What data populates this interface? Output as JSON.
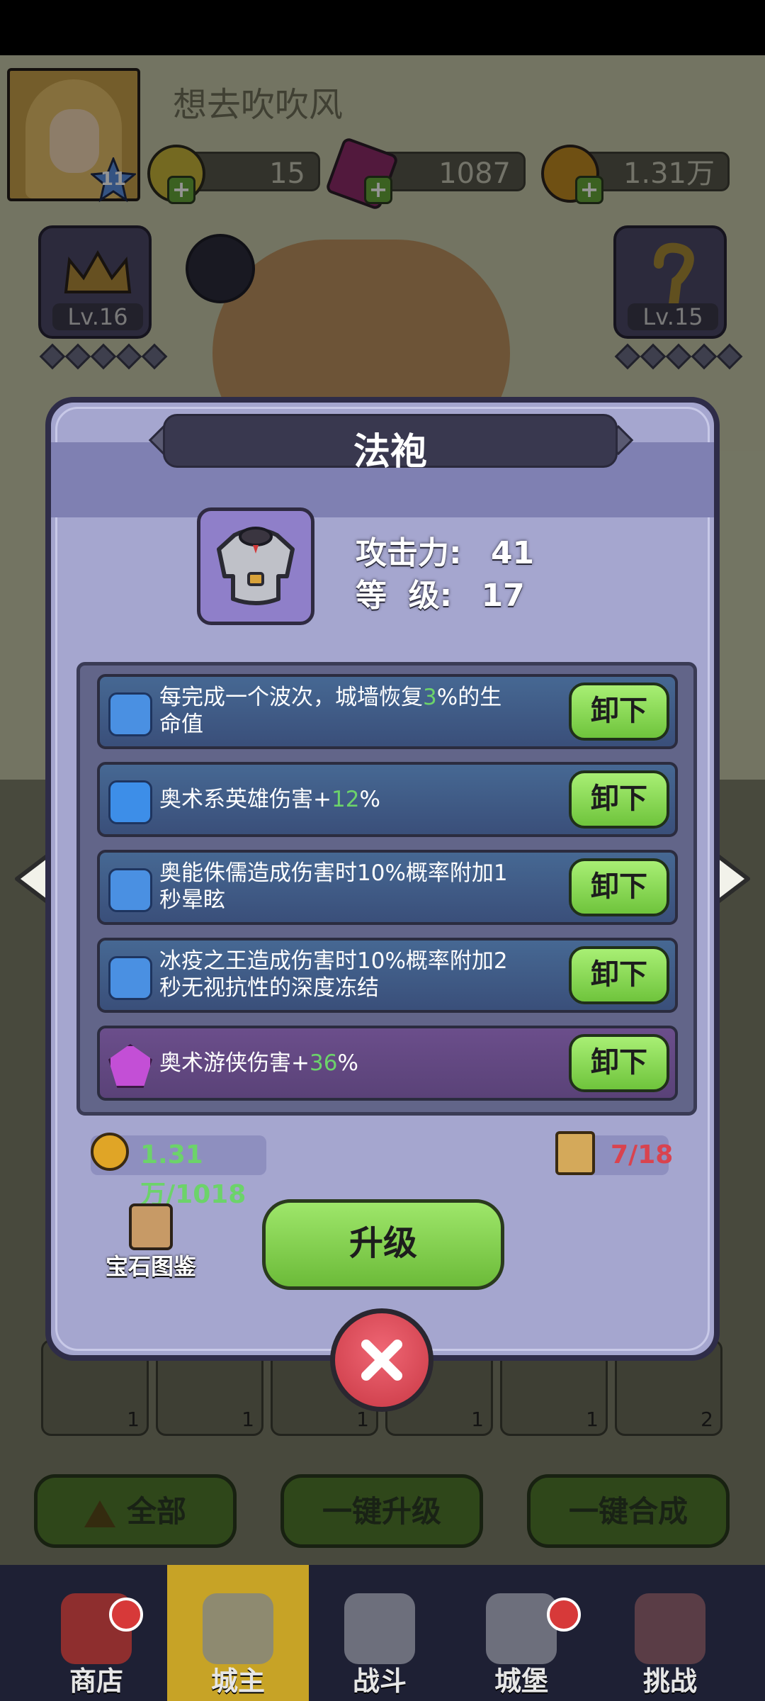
{
  "player": {
    "name": "想去吹吹风",
    "level": "11"
  },
  "resources": [
    {
      "icon": "hex-gem-icon",
      "value": "15"
    },
    {
      "icon": "crystal-icon",
      "value": "1087"
    },
    {
      "icon": "gold-coin-icon",
      "value": "1.31万"
    }
  ],
  "equip_slots": {
    "left_level": "Lv.16",
    "right_level": "Lv.15"
  },
  "bottom_buttons": {
    "all": "全部",
    "upgrade_all": "一键升级",
    "merge_all": "一键合成"
  },
  "nav": [
    {
      "label": "商店",
      "icon": "shop-icon"
    },
    {
      "label": "城主",
      "icon": "crown-icon"
    },
    {
      "label": "战斗",
      "icon": "swords-icon"
    },
    {
      "label": "城堡",
      "icon": "castle-icon"
    },
    {
      "label": "挑战",
      "icon": "demon-icon"
    }
  ],
  "inventory_counts": [
    "1",
    "1",
    "1",
    "1",
    "1",
    "2"
  ],
  "dialog": {
    "title": "法袍",
    "stats": {
      "attack_label": "攻击力:",
      "attack_value": "41",
      "level_label": "等  级:",
      "level_value": "17"
    },
    "gems": [
      {
        "icon": "blue-swirl-gem-icon",
        "pre": "每完成一个波次，城墙恢复",
        "hl": "3",
        "post": "%的生命值",
        "button": "卸下"
      },
      {
        "icon": "blue-hex-gem-icon",
        "pre": "奥术系英雄伤害+",
        "hl": "12",
        "post": "%",
        "button": "卸下"
      },
      {
        "icon": "blue-swirl-gem-icon",
        "pre": "奥能侏儒造成伤害时10%概率附加1秒晕眩",
        "hl": "",
        "post": "",
        "button": "卸下"
      },
      {
        "icon": "blue-swirl-gem-icon",
        "pre": "冰疫之王造成伤害时10%概率附加2秒无视抗性的深度冻结",
        "hl": "",
        "post": "",
        "button": "卸下"
      },
      {
        "icon": "purple-gem-icon",
        "pre": "奥术游侠伤害+",
        "hl": "36",
        "post": "%",
        "button": "卸下"
      }
    ],
    "gold_cost": "1.31万/1018",
    "scroll_cost": "7/18",
    "gem_codex": "宝石图鉴",
    "upgrade_button": "升级"
  },
  "colors": {
    "green_highlight": "#6cd36a",
    "red_cost": "#d9434f",
    "dialog_bg": "#a5a6cf"
  }
}
